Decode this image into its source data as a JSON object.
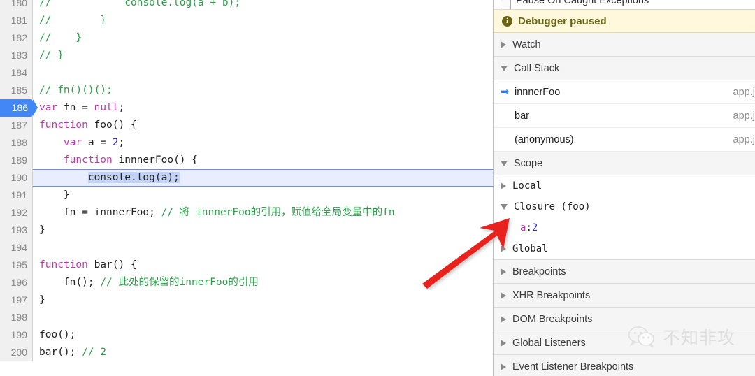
{
  "editor": {
    "name": "sources-code-editor",
    "language": "javascript",
    "lines": [
      {
        "num": "180",
        "current": false,
        "breakpoint": false,
        "tokens": [
          {
            "t": "//            console.log(a + b);",
            "c": "c-com"
          }
        ]
      },
      {
        "num": "181",
        "current": false,
        "breakpoint": false,
        "tokens": [
          {
            "t": "//        }",
            "c": "c-com"
          }
        ]
      },
      {
        "num": "182",
        "current": false,
        "breakpoint": false,
        "tokens": [
          {
            "t": "//    }",
            "c": "c-com"
          }
        ]
      },
      {
        "num": "183",
        "current": false,
        "breakpoint": false,
        "tokens": [
          {
            "t": "// }",
            "c": "c-com"
          }
        ]
      },
      {
        "num": "184",
        "current": false,
        "breakpoint": false,
        "tokens": []
      },
      {
        "num": "185",
        "current": false,
        "breakpoint": false,
        "tokens": [
          {
            "t": "// fn()()();",
            "c": "c-com"
          }
        ]
      },
      {
        "num": "186",
        "current": false,
        "breakpoint": true,
        "tokens": [
          {
            "t": "var",
            "c": "c-kw"
          },
          {
            "t": " fn = ",
            "c": "c-plain"
          },
          {
            "t": "null",
            "c": "c-kw"
          },
          {
            "t": ";",
            "c": "c-plain"
          }
        ]
      },
      {
        "num": "187",
        "current": false,
        "breakpoint": false,
        "tokens": [
          {
            "t": "function",
            "c": "c-kw"
          },
          {
            "t": " foo() {",
            "c": "c-plain"
          }
        ]
      },
      {
        "num": "188",
        "current": false,
        "breakpoint": false,
        "tokens": [
          {
            "t": "    ",
            "c": "c-plain"
          },
          {
            "t": "var",
            "c": "c-kw"
          },
          {
            "t": " a = ",
            "c": "c-plain"
          },
          {
            "t": "2",
            "c": "c-num"
          },
          {
            "t": ";",
            "c": "c-plain"
          }
        ]
      },
      {
        "num": "189",
        "current": false,
        "breakpoint": false,
        "tokens": [
          {
            "t": "    ",
            "c": "c-plain"
          },
          {
            "t": "function",
            "c": "c-kw"
          },
          {
            "t": " innnerFoo() {",
            "c": "c-plain"
          }
        ]
      },
      {
        "num": "190",
        "current": true,
        "breakpoint": false,
        "tokens": [
          {
            "t": "        ",
            "c": "c-plain"
          },
          {
            "t": "console.log(a);",
            "c": "c-plain",
            "sel": true
          }
        ]
      },
      {
        "num": "191",
        "current": false,
        "breakpoint": false,
        "tokens": [
          {
            "t": "    }",
            "c": "c-plain"
          }
        ]
      },
      {
        "num": "192",
        "current": false,
        "breakpoint": false,
        "tokens": [
          {
            "t": "    fn = innnerFoo; ",
            "c": "c-plain"
          },
          {
            "t": "// 将 innnerFoo的引用，赋值给全局变量中的fn",
            "c": "c-cn"
          }
        ]
      },
      {
        "num": "193",
        "current": false,
        "breakpoint": false,
        "tokens": [
          {
            "t": "}",
            "c": "c-plain"
          }
        ]
      },
      {
        "num": "194",
        "current": false,
        "breakpoint": false,
        "tokens": []
      },
      {
        "num": "195",
        "current": false,
        "breakpoint": false,
        "tokens": [
          {
            "t": "function",
            "c": "c-kw"
          },
          {
            "t": " bar() {",
            "c": "c-plain"
          }
        ]
      },
      {
        "num": "196",
        "current": false,
        "breakpoint": false,
        "tokens": [
          {
            "t": "    fn(); ",
            "c": "c-plain"
          },
          {
            "t": "// 此处的保留的innerFoo的引用",
            "c": "c-cn"
          }
        ]
      },
      {
        "num": "197",
        "current": false,
        "breakpoint": false,
        "tokens": [
          {
            "t": "}",
            "c": "c-plain"
          }
        ]
      },
      {
        "num": "198",
        "current": false,
        "breakpoint": false,
        "tokens": []
      },
      {
        "num": "199",
        "current": false,
        "breakpoint": false,
        "tokens": [
          {
            "t": "foo();",
            "c": "c-plain"
          }
        ]
      },
      {
        "num": "200",
        "current": false,
        "breakpoint": false,
        "tokens": [
          {
            "t": "bar(); ",
            "c": "c-plain"
          },
          {
            "t": "// 2",
            "c": "c-com"
          }
        ]
      }
    ]
  },
  "sidebar": {
    "pause_on_caught_exceptions": {
      "label": "Pause On Caught Exceptions",
      "checked": false
    },
    "paused_banner": {
      "icon": "info-icon",
      "text": "Debugger paused"
    },
    "watch": {
      "label": "Watch",
      "expanded": false
    },
    "call_stack": {
      "label": "Call Stack",
      "expanded": true,
      "frames": [
        {
          "name": "innnerFoo",
          "location": "app.j",
          "active": true
        },
        {
          "name": "bar",
          "location": "app.j",
          "active": false
        },
        {
          "name": "(anonymous)",
          "location": "app.j",
          "active": false
        }
      ]
    },
    "scope": {
      "label": "Scope",
      "expanded": true,
      "entries": [
        {
          "label": "Local",
          "expanded": false,
          "kind": "scope"
        },
        {
          "label": "Closure (foo)",
          "expanded": true,
          "kind": "scope"
        },
        {
          "key": "a",
          "colon": ":",
          "value": "2",
          "kind": "property"
        },
        {
          "label": "Global",
          "expanded": false,
          "kind": "scope"
        }
      ]
    },
    "sections": [
      {
        "label": "Breakpoints",
        "expanded": false
      },
      {
        "label": "XHR Breakpoints",
        "expanded": false
      },
      {
        "label": "DOM Breakpoints",
        "expanded": false
      },
      {
        "label": "Global Listeners",
        "expanded": false
      },
      {
        "label": "Event Listener Breakpoints",
        "expanded": false
      }
    ]
  },
  "annotation": {
    "arrow": {
      "name": "red-arrow-annotation",
      "color": "#e8241c"
    }
  },
  "watermark": {
    "icon": "wechat-icon",
    "text": "不知非攻"
  },
  "colors": {
    "breakpoint": "#4287f5",
    "exec_line_bg": "#e8eeff",
    "paused_bg": "#fff8dc",
    "paused_fg": "#6b6416",
    "comment": "#2e9e4b",
    "keyword": "#c436b0",
    "number": "#2f2fd0",
    "arrow": "#e8241c"
  }
}
